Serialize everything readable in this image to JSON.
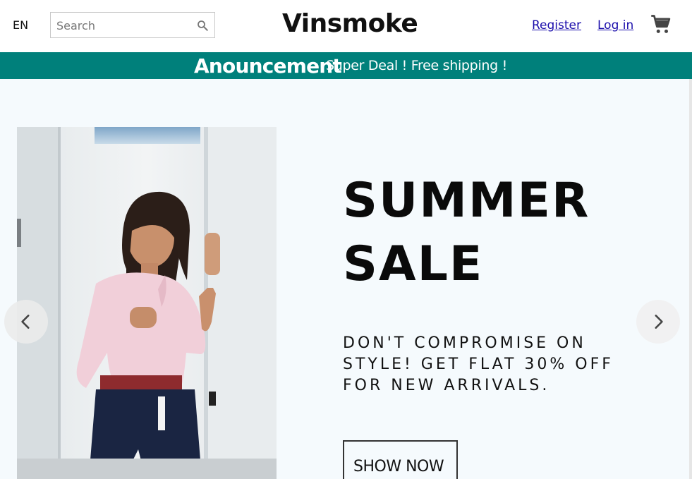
{
  "navbar": {
    "language": "EN",
    "search": {
      "placeholder": "Search",
      "value": ""
    },
    "logo": "Vinsmoke",
    "register_label": "Register",
    "login_label": "Log in"
  },
  "announcement": {
    "title": "Anouncement",
    "text": "Super Deal ! Free shipping !"
  },
  "slider": {
    "headline_line1": "SUMMER",
    "headline_line2": "SALE",
    "desc_line1": "DON'T COMPROMISE ON",
    "desc_line2": "STYLE! GET FLAT 30% OFF",
    "desc_line3": "FOR NEW ARRIVALS.",
    "cta_label": "SHOW NOW"
  },
  "colors": {
    "announcement_bg": "#00807b",
    "hero_bg": "#f5fafd",
    "link": "#1a0dab"
  },
  "icons": [
    "search-icon",
    "cart-icon",
    "chevron-left-icon",
    "chevron-right-icon"
  ]
}
